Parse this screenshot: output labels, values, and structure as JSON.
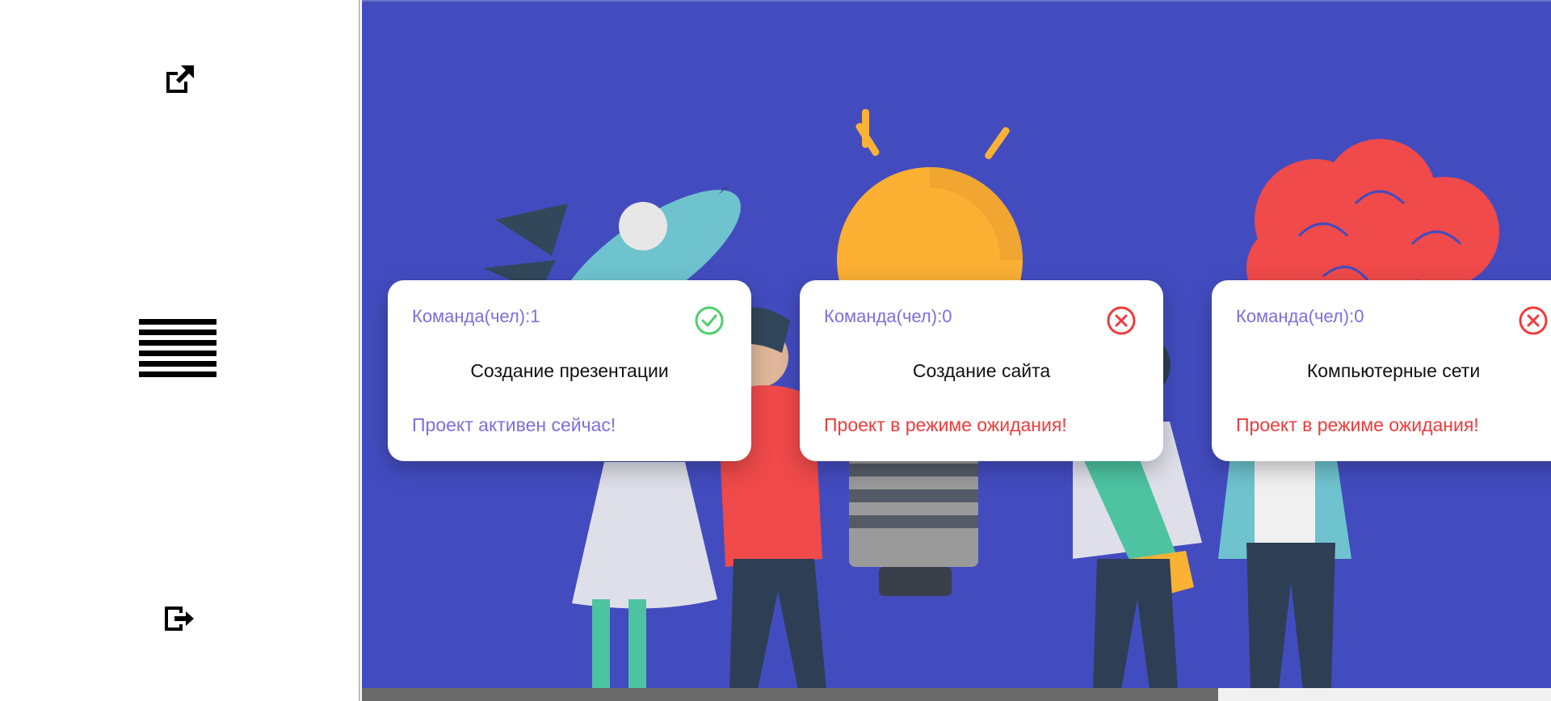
{
  "colors": {
    "main_background": "#434cbf",
    "accent_purple": "#7c6fe0",
    "status_ok": "#4cd06a",
    "status_waiting": "#ef3b3b"
  },
  "sidebar": {
    "open_icon": "external-link-icon",
    "menu_icon": "hamburger-menu-icon",
    "exit_icon": "logout-icon"
  },
  "projects": [
    {
      "team": "Команда(чел):1",
      "title": "Создание презентации",
      "status": "Проект активен сейчас!",
      "state_icon": "check-circle-icon"
    },
    {
      "team": "Команда(чел):0",
      "title": "Создание сайта",
      "status": "Проект в режиме ожидания!",
      "state_icon": "x-circle-icon"
    },
    {
      "team": "Команда(чел):0",
      "title": "Компьютерные сети",
      "status": "Проект в режиме ожидания!",
      "state_icon": "x-circle-icon"
    }
  ]
}
